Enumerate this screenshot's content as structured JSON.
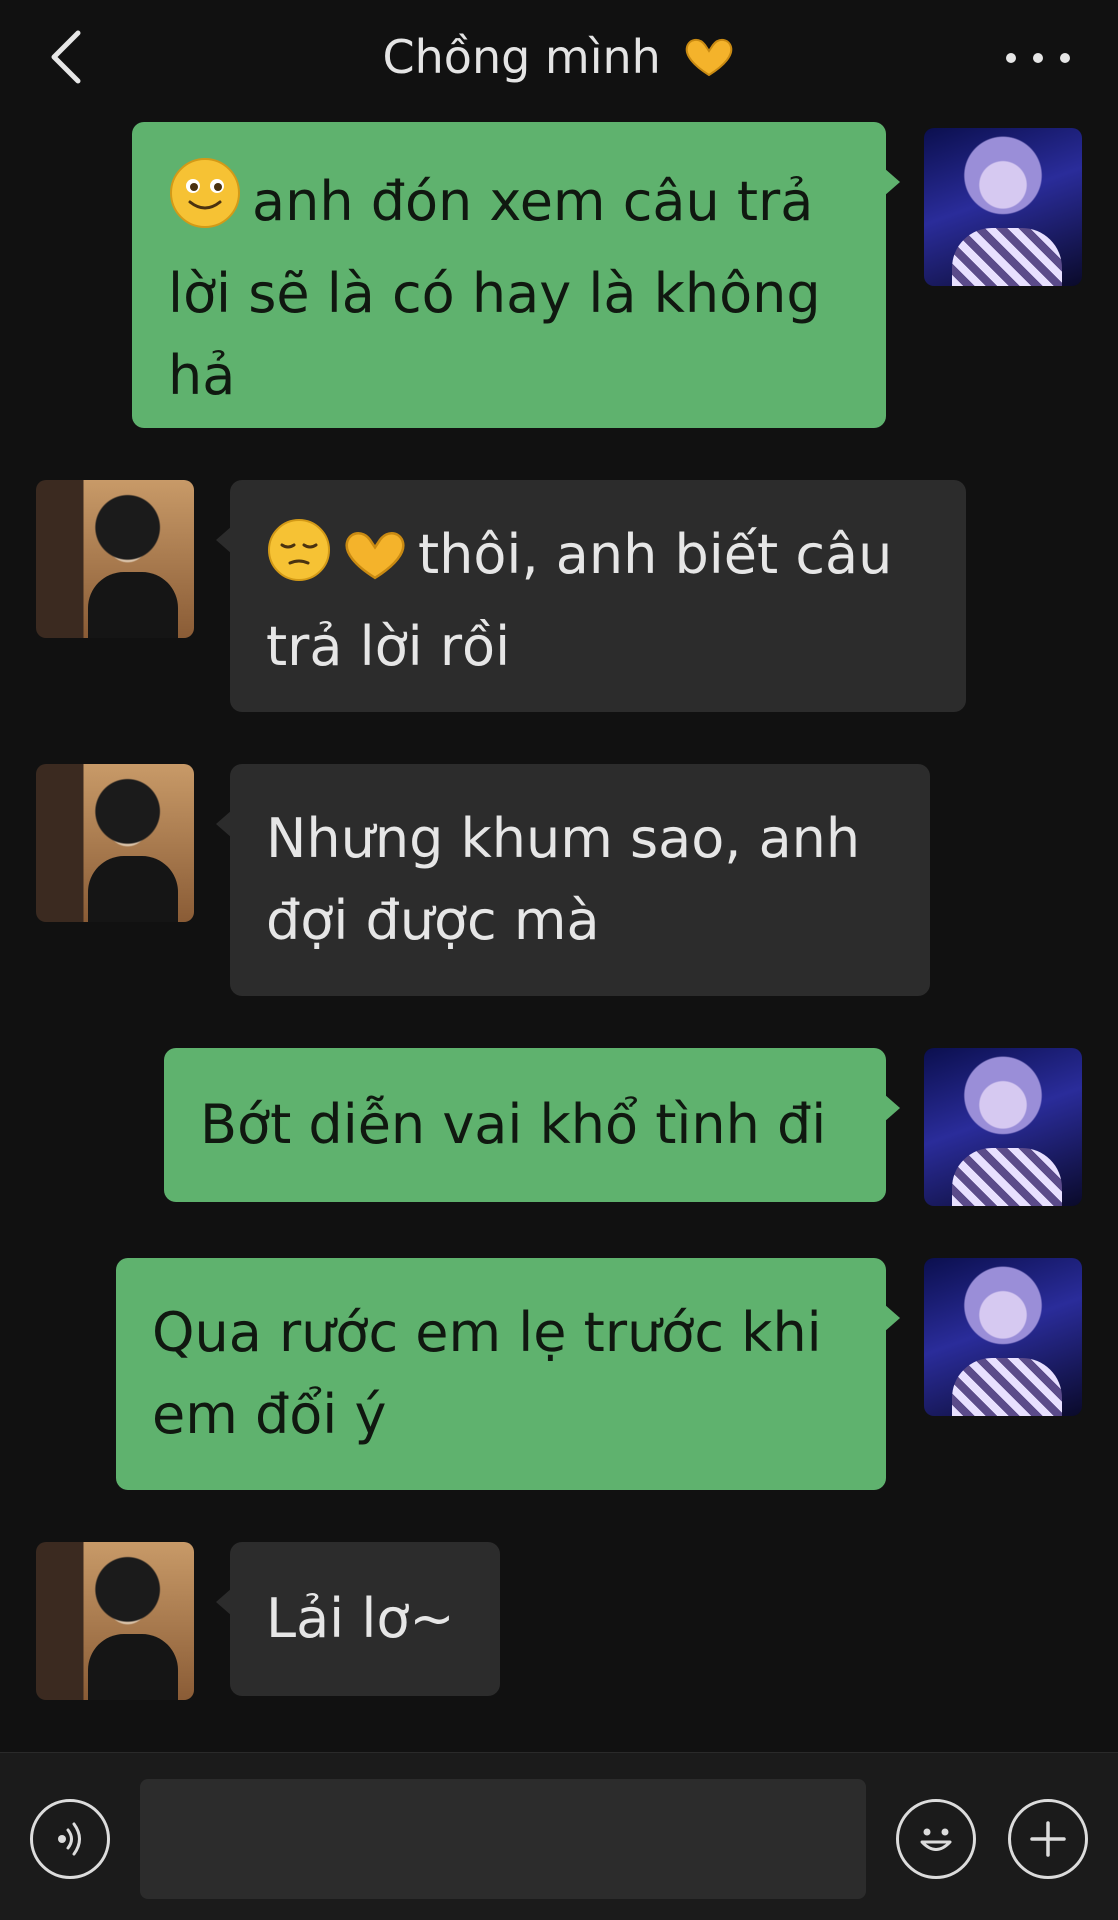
{
  "header": {
    "title": "Chồng mình",
    "back_icon": "chevron-left-icon",
    "more_icon": "more-horizontal-icon",
    "title_emoji": "heart-hands-emoji"
  },
  "messages": [
    {
      "side": "me",
      "emoji": "smiling-face-emoji",
      "text": "anh đón xem câu trả lời sẽ là có hay là không hả"
    },
    {
      "side": "him",
      "emoji": "pensive-face-and-heart-hands-emoji",
      "text": "thôi, anh biết câu trả lời rồi"
    },
    {
      "side": "him",
      "text": "Nhưng khum sao, anh đợi được mà"
    },
    {
      "side": "me",
      "text": "Bớt diễn vai khổ tình đi"
    },
    {
      "side": "me",
      "text": "Qua rước em lẹ trước khi em đổi ý"
    },
    {
      "side": "him",
      "text": "Lải lơ~"
    }
  ],
  "input_bar": {
    "voice_icon": "voice-icon",
    "text_value": "",
    "emoji_icon": "emoji-face-icon",
    "plus_icon": "plus-icon"
  },
  "colors": {
    "background": "#111111",
    "my_bubble": "#5fb26e",
    "their_bubble": "#2c2c2c"
  }
}
